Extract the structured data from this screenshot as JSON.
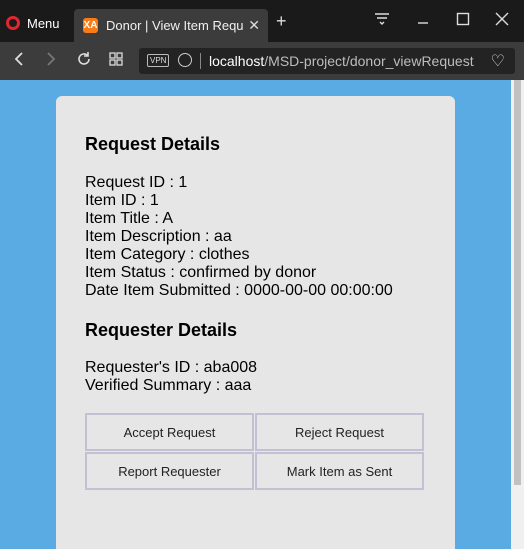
{
  "browser": {
    "menu_label": "Menu",
    "tab_title": "Donor | View Item Request",
    "url_host": "localhost",
    "url_path": "/MSD-project/donor_viewRequest.php",
    "vpn_label": "VPN",
    "favicon_letter": "XA",
    "close_glyph": "✕",
    "new_tab_glyph": "+"
  },
  "request": {
    "heading": "Request Details",
    "fields": [
      "Request ID : 1",
      "Item ID : 1",
      "Item Title : A",
      "Item Description : aa",
      "Item Category : clothes",
      "Item Status : confirmed by donor",
      "Date Item Submitted : 0000-00-00 00:00:00"
    ]
  },
  "requester": {
    "heading": "Requester Details",
    "fields": [
      "Requester's ID : aba008",
      "Verified Summary : aaa"
    ]
  },
  "actions": {
    "accept": "Accept Request",
    "reject": "Reject Request",
    "report": "Report Requester",
    "mark_sent": "Mark Item as Sent"
  },
  "colors": {
    "page_bg": "#5aaae4",
    "card_bg": "#e6e6e6",
    "button_border": "#c4c0d4",
    "chrome_dark": "#1a1a1a"
  }
}
